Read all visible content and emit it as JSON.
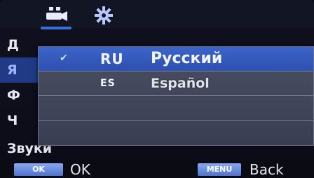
{
  "topbar": {
    "tabs": [
      {
        "icon": "video-camera-icon",
        "active": true
      },
      {
        "icon": "gear-icon",
        "active": false
      }
    ],
    "accent": "#3b6fd8"
  },
  "background_menu": {
    "items": [
      {
        "label": "Д",
        "selected": false
      },
      {
        "label": "Я",
        "selected": true
      },
      {
        "label": "Ф",
        "selected": false
      },
      {
        "label": "Ч",
        "selected": false
      },
      {
        "label": "Звуки",
        "selected": false
      }
    ]
  },
  "language_dialog": {
    "options": [
      {
        "code": "RU",
        "name": "Русский",
        "checked": true
      },
      {
        "code": "ES",
        "name": "Español",
        "checked": false
      },
      {
        "code": "",
        "name": "",
        "checked": false
      },
      {
        "code": "",
        "name": "",
        "checked": false
      }
    ],
    "highlight": "#3c64c8"
  },
  "bottom_bar": {
    "ok_key": "OK",
    "ok_label": "OK",
    "menu_key": "MENU",
    "back_label": "Back"
  }
}
